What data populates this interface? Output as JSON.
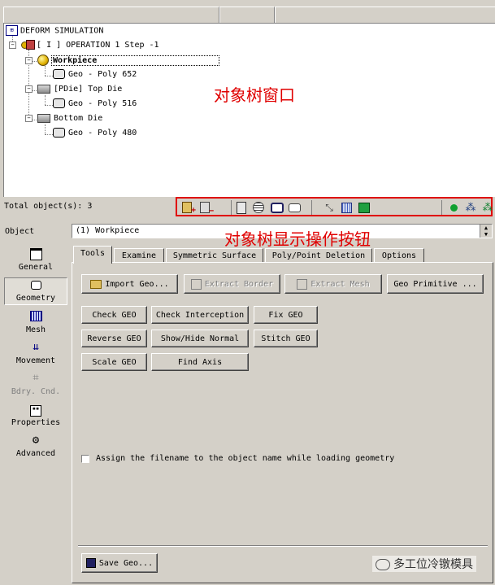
{
  "tree": {
    "root": "DEFORM SIMULATION",
    "operation": "[ I ]  OPERATION 1  Step -1",
    "workpiece": "Workpiece",
    "workpiece_geo": "Geo - Poly 652",
    "top_die": "[PDie] Top Die",
    "top_die_geo": "Geo - Poly 516",
    "bottom_die": "Bottom Die",
    "bottom_die_geo": "Geo - Poly 480"
  },
  "annotations": {
    "tree_window": "对象树窗口",
    "tree_buttons": "对象树显示操作按钮"
  },
  "status": {
    "total_objects": "Total object(s): 3"
  },
  "object_bar": {
    "label": "Object",
    "selected": "(1) Workpiece"
  },
  "sidebar": {
    "items": [
      {
        "label": "General",
        "icon": "general-icon"
      },
      {
        "label": "Geometry",
        "icon": "geometry-icon"
      },
      {
        "label": "Mesh",
        "icon": "mesh-icon"
      },
      {
        "label": "Movement",
        "icon": "movement-icon"
      },
      {
        "label": "Bdry. Cnd.",
        "icon": "boundary-icon"
      },
      {
        "label": "Properties",
        "icon": "properties-icon"
      },
      {
        "label": "Advanced",
        "icon": "advanced-icon"
      }
    ]
  },
  "tabs": [
    "Tools",
    "Examine",
    "Symmetric Surface",
    "Poly/Point Deletion",
    "Options"
  ],
  "buttons": {
    "import_geo": "Import Geo...",
    "extract_border": "Extract Border",
    "extract_mesh": "Extract Mesh",
    "geo_primitive": "Geo Primitive ...",
    "check_geo": "Check GEO",
    "check_interception": "Check Interception",
    "fix_geo": "Fix GEO",
    "reverse_geo": "Reverse GEO",
    "show_hide_normal": "Show/Hide Normal",
    "stitch_geo": "Stitch GEO",
    "scale_geo": "Scale GEO",
    "find_axis": "Find Axis",
    "save_geo": "Save Geo..."
  },
  "checkbox": {
    "label": "Assign the filename to the object name while loading geometry",
    "checked": false
  },
  "watermark": "多工位冷镦模具",
  "colors": {
    "annotation": "#e00000",
    "panel": "#d4d0c8"
  }
}
